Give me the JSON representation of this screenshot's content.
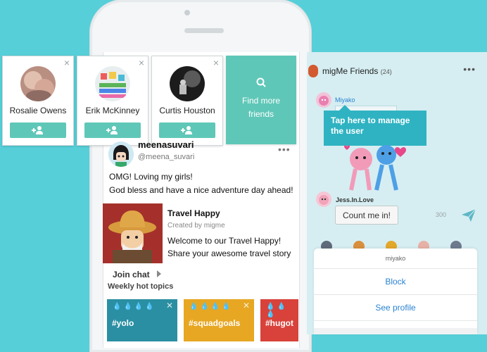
{
  "colors": {
    "background": "#56cfd9",
    "accent_green": "#5fc7b8",
    "chat_bg": "#d6eef2",
    "tooltip": "#2fb3c2",
    "link_blue": "#2a83d2"
  },
  "suggestions": [
    {
      "name": "Rosalie Owens",
      "close": "×"
    },
    {
      "name": "Erik McKinney",
      "close": "×"
    },
    {
      "name": "Curtis Houston",
      "close": "×"
    }
  ],
  "find_more": {
    "label_line1": "Find more",
    "label_line2": "friends",
    "icon": "search-icon"
  },
  "post": {
    "author": "meenasuvari",
    "handle": "@meena_suvari",
    "more": "•••",
    "text_line1": "OMG! Loving my girls!",
    "text_line2": "God bless and have a nice adventure day ahead!"
  },
  "group": {
    "title": "Travel Happy",
    "created_by": "Created by migme",
    "desc_line1": "Welcome to our Travel Happy!",
    "desc_line2": "Share your awesome travel story",
    "join_label": "Join chat"
  },
  "weekly": {
    "label": "Weekly hot topics",
    "topics": [
      {
        "tag": "#yolo",
        "color": "#2b8fa3"
      },
      {
        "tag": "#squadgoals",
        "color": "#e7a722"
      },
      {
        "tag": "#hugot",
        "color": "#d8423a"
      }
    ]
  },
  "chat": {
    "title": "migMe Friends",
    "count": "(24)",
    "menu_dots": "•••",
    "sender1": "Miyako",
    "tooltip_line1": "Tap here to manage",
    "tooltip_line2": "the user",
    "sender2": "Jess.In.Love",
    "reply_button": "Count me in!",
    "char_count": "300"
  },
  "action_menu": {
    "header": "miyako",
    "block": "Block",
    "see_profile": "See profile"
  }
}
